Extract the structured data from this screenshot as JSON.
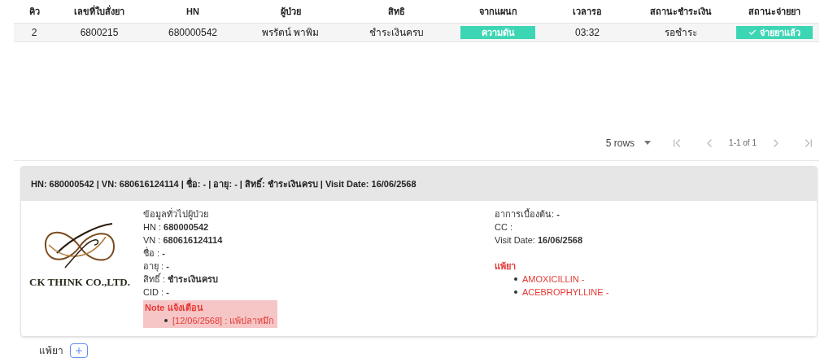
{
  "table": {
    "columns": [
      "คิว",
      "เลขที่ใบสั่งยา",
      "HN",
      "ผู้ป่วย",
      "สิทธิ",
      "จากแผนก",
      "เวลารอ",
      "สถานะชำระเงิน",
      "สถานะจ่ายยา"
    ],
    "rows": [
      {
        "cells": [
          {
            "kind": "text",
            "text": "2"
          },
          {
            "kind": "text",
            "text": "6800215"
          },
          {
            "kind": "text",
            "text": "680000542"
          },
          {
            "kind": "text",
            "text": "พรรัตน์ พาพิม"
          },
          {
            "kind": "text",
            "text": "ชำระเงินครบ"
          },
          {
            "kind": "badge",
            "text": "ความดัน"
          },
          {
            "kind": "text",
            "text": "03:32"
          },
          {
            "kind": "text",
            "text": "รอชำระ"
          },
          {
            "kind": "check_badge",
            "text": "จ่ายยาแล้ว"
          }
        ]
      }
    ]
  },
  "pagination": {
    "rows_per_page": "5 rows",
    "range": "1-1 of 1"
  },
  "card": {
    "header": "HN: 680000542 | VN: 680616124114 | ชื่อ: - | อายุ: - | สิทธิ์: ชำระเงินครบ | Visit Date: 16/06/2568",
    "logo_text": "CK THINK CO.,LTD.",
    "info_title": "ข้อมูลทั่วไปผู้ป่วย",
    "info_lines": [
      "HN : **680000542**",
      "VN : **680616124114**",
      "ชื่อ : **-**",
      "อายุ : **-**",
      "สิทธิ์ : **ชำระเงินครบ**",
      "CID : **-**"
    ],
    "note": {
      "title": "Note แจ้งเตือน",
      "items": [
        "[12/06/2568] : แพ้ปลาหมึก"
      ]
    },
    "right_lines": [
      "อาการเบื้องต้น: **-**",
      "CC :",
      "Visit Date: **16/06/2568**"
    ],
    "allergy": {
      "title": "แพ้ยา",
      "items": [
        "AMOXICILLIN -",
        "ACEBROPHYLLINE -"
      ]
    }
  },
  "bottom_tab": {
    "label": "แพ้ยา"
  }
}
